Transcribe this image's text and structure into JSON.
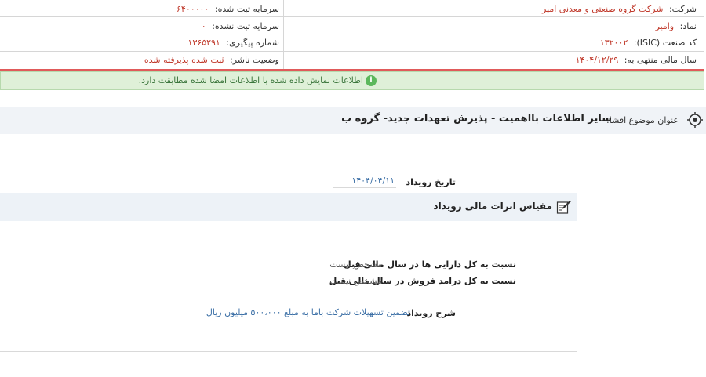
{
  "company_info": {
    "company_label": "شرکت:",
    "company_value": "شرکت گروه صنعتی و معدنی امیر",
    "symbol_label": "نماد:",
    "symbol_value": "وامیر",
    "isic_label": "کد صنعت (ISIC):",
    "isic_value": "۱۳۲۰۰۲",
    "fiscal_label": "سال مالی منتهی به:",
    "fiscal_value": "۱۴۰۴/۱۲/۲۹",
    "registered_capital_label": "سرمایه ثبت شده:",
    "registered_capital_value": "۶۴۰۰۰۰۰",
    "unregistered_capital_label": "سرمایه ثبت نشده:",
    "unregistered_capital_value": "۰",
    "tracking_label": "شماره پیگیری:",
    "tracking_value": "۱۳۶۵۲۹۱",
    "publisher_status_label": "وضعیت ناشر:",
    "publisher_status_value": "ثبت شده پذیرفته شده"
  },
  "banner": {
    "icon": "info-icon",
    "text": "اطلاعات نمایش داده شده با اطلاعات امضا شده مطابقت دارد.",
    "color": "#3c763d"
  },
  "disclosure": {
    "subject_label": "عنوان موضوع افشا:",
    "subject_value": "سایر اطلاعات بااهمیت - پذیرش تعهدات جدید- گروه ب",
    "event_date_label": "تاریخ رویداد",
    "event_date_value": "۱۴۰۴/۰۴/۱۱",
    "section_title": "مقیاس اثرات مالی رویداد",
    "assets_ratio_label": "نسبت به کل دارایی ها در سال مالی قبل",
    "assets_ratio_value": "مشخص نیست",
    "sales_ratio_label": "نسبت به کل درامد فروش در سال مالی قبل",
    "sales_ratio_value": "مشخص نیست",
    "description_label": "شرح رویداد",
    "description_value": "تضمین تسهیلات شرکت باما به مبلغ ۵۰۰،۰۰۰ میلیون ریال"
  }
}
